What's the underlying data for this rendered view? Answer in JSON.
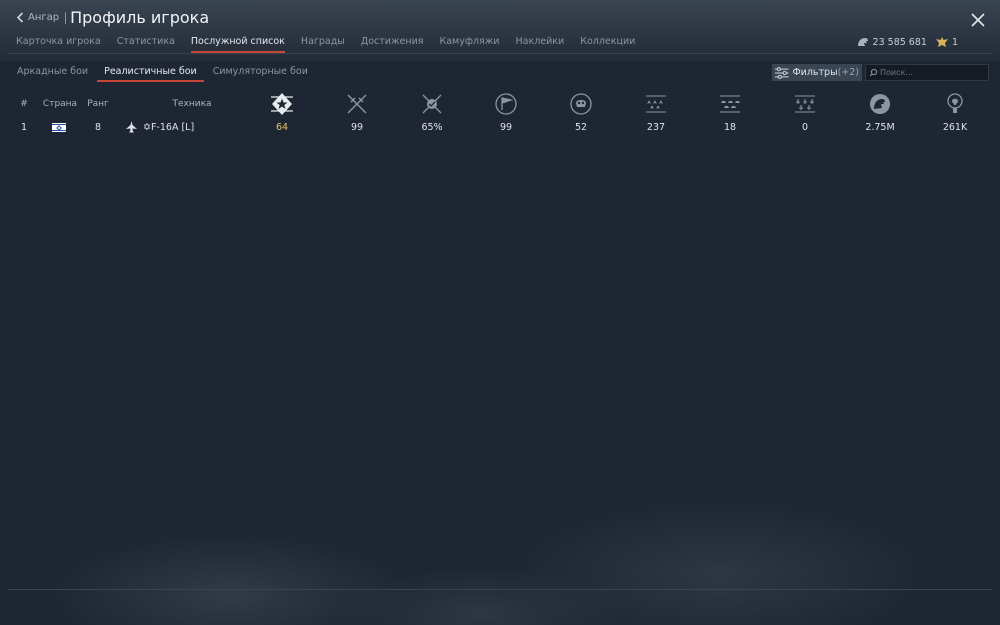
{
  "header": {
    "back_label": "Ангар",
    "title": "Профиль игрока"
  },
  "tabs": [
    {
      "label": "Карточка игрока"
    },
    {
      "label": "Статистика"
    },
    {
      "label": "Послужной список",
      "active": true
    },
    {
      "label": "Награды"
    },
    {
      "label": "Достижения"
    },
    {
      "label": "Камуфляжи"
    },
    {
      "label": "Наклейки"
    },
    {
      "label": "Коллекции"
    }
  ],
  "currency": {
    "silver": "23 585 681",
    "eagles": "1"
  },
  "subtabs": [
    {
      "label": "Аркадные бои"
    },
    {
      "label": "Реалистичные бои",
      "active": true
    },
    {
      "label": "Симуляторные бои"
    }
  ],
  "filter": {
    "label": "Фильтры",
    "count": "(+2)"
  },
  "search": {
    "placeholder": "Поиск..."
  },
  "table": {
    "columns": {
      "index": "#",
      "country": "Страна",
      "rank": "Ранг",
      "vehicle": "Техника"
    },
    "stat_icons": [
      "battles-icon",
      "victories-icon",
      "win-rate-icon",
      "missions-icon",
      "deaths-icon",
      "air-kills-icon",
      "ground-kills-icon",
      "naval-kills-icon",
      "silver-earned-icon",
      "research-points-icon"
    ],
    "rows": [
      {
        "index": "1",
        "country": "israel-flag",
        "rank": "8",
        "vehicle_icon": "jet-icon",
        "vehicle": "✡F-16A [L]",
        "stats": [
          "64",
          "99",
          "65%",
          "99",
          "52",
          "237",
          "18",
          "0",
          "2.75M",
          "261K"
        ]
      }
    ]
  },
  "colors": {
    "accent": "#c8453a",
    "highlight": "#e8c36a",
    "background": "#1d2632"
  }
}
